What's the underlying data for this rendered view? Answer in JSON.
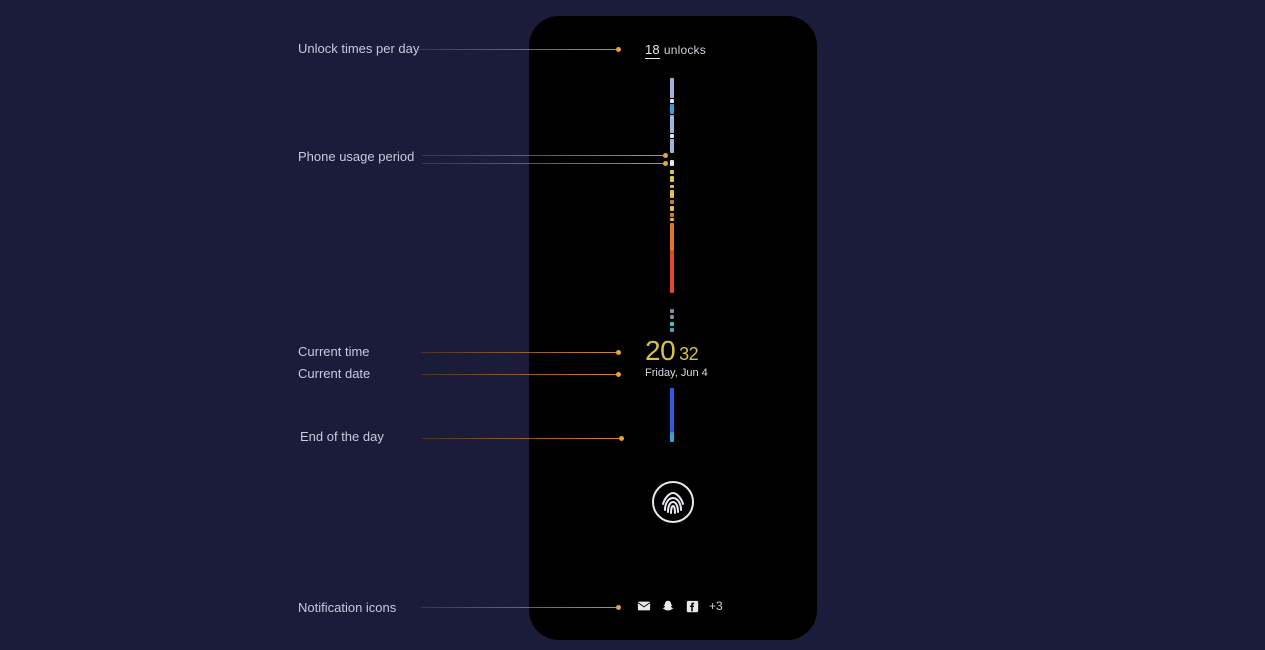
{
  "labels": {
    "unlock_times": "Unlock times per day",
    "usage_period": "Phone usage period",
    "current_time": "Current time",
    "current_date": "Current date",
    "end_of_day": "End of the day",
    "notifications": "Notification icons"
  },
  "unlocks": {
    "count": "18",
    "word": "unlocks"
  },
  "clock": {
    "hh": "20",
    "mm": "32"
  },
  "date": "Friday, Jun 4",
  "notif_extra": "+3",
  "icons": {
    "mail": "mail-icon",
    "snapchat": "snapchat-icon",
    "facebook": "facebook-icon",
    "fingerprint": "fingerprint-icon"
  }
}
